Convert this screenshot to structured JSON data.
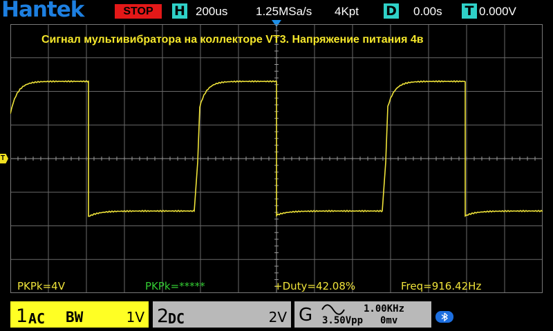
{
  "header": {
    "brand": "Hantek",
    "run_state": "STOP",
    "horizontal_key": "H",
    "timebase": "200us",
    "sample_rate": "1.25MSa/s",
    "memory_depth": "4Kpt",
    "delay_key": "D",
    "delay": "0.00s",
    "trigger_key": "T",
    "trigger_level": "0.000V"
  },
  "display": {
    "title": "Сигнал мультивибратора на коллекторе VT3. Напряжение питания 4в",
    "trigger_marker": "T"
  },
  "measurements": {
    "pkpk_ch1": "PKPk=4V",
    "pkpk_ch2": "PKPk=*****",
    "duty": "+Duty=42.08%",
    "freq": "Freq=916.42Hz"
  },
  "channels": [
    {
      "number": "1",
      "coupling": "AC",
      "bw": "BW",
      "scale": "1V"
    },
    {
      "number": "2",
      "coupling": "DC",
      "scale": "2V"
    }
  ],
  "generator": {
    "label": "G",
    "frequency": "1.00KHz",
    "amplitude": "3.50Vpp",
    "offset": "0mv"
  },
  "colors": {
    "brand": "#1d7fe0",
    "stop": "#e31818",
    "key": "#2fd1c8",
    "trace": "#f0e43a",
    "title": "#f6e82b",
    "ch1": "#ffff24",
    "ch2": "#b9b9b9",
    "meas_ch2": "#33cc33"
  },
  "icons": {
    "bluetooth": "bluetooth-icon",
    "sine": "sine-wave-icon"
  }
}
